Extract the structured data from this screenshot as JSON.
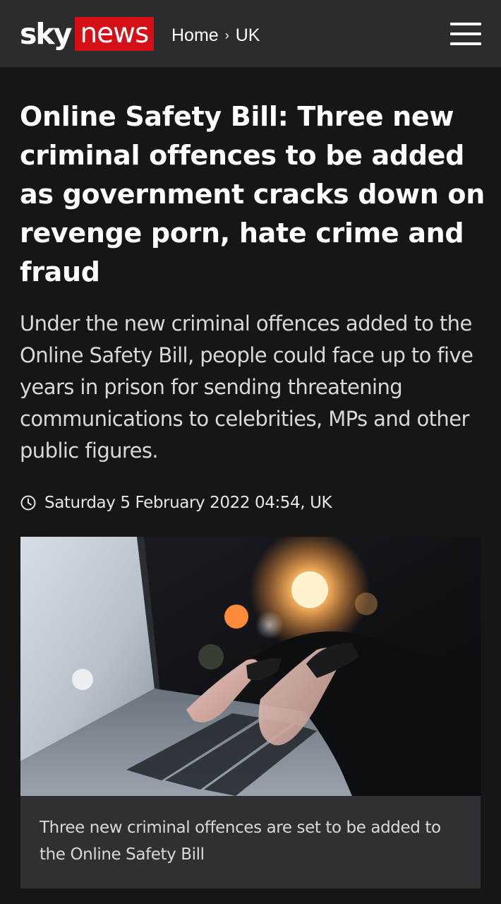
{
  "header": {
    "logo_sky": "sky",
    "logo_news": "news",
    "breadcrumb": [
      "Home",
      "UK"
    ],
    "breadcrumb_separator": "›",
    "menu_icon": "hamburger-menu-icon",
    "brand_red": "#d50f15",
    "background": "#2c2c2e"
  },
  "article": {
    "headline": "Online Safety Bill: Three new criminal offences to be added as government cracks down on revenge porn, hate crime and fraud",
    "standfirst": "Under the new criminal offences added to the Online Safety Bill, people could face up to five years in prison for sending threatening communications to celebrities, MPs and other public figures.",
    "timestamp": "Saturday 5 February 2022 04:54, UK",
    "timestamp_icon": "clock-icon"
  },
  "figure": {
    "image_icon": "photo-hands-typing-on-laptop",
    "caption": "Three new criminal offences are set to be added to the Online Safety Bill"
  }
}
